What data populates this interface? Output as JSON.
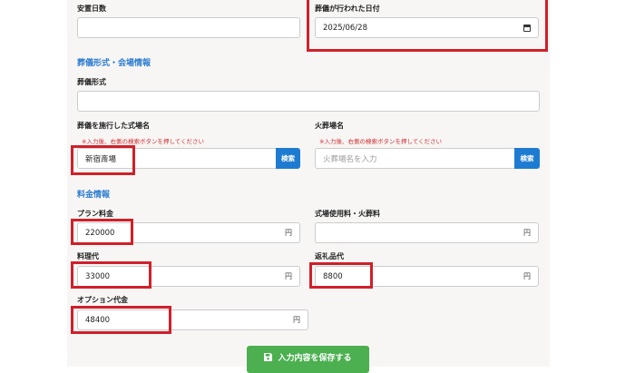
{
  "fields": {
    "anchi_days": {
      "label": "安置日数",
      "value": ""
    },
    "funeral_date": {
      "label": "葬儀が行われた日付",
      "value": "2025/06/28"
    },
    "funeral_type": {
      "label": "葬儀形式",
      "value": ""
    },
    "venue": {
      "label": "葬儀を施行した式場名",
      "note": "※入力後、右側の検索ボタンを押してください",
      "value": "新宿斎場",
      "search_label": "検索"
    },
    "crematorium": {
      "label": "火葬場名",
      "note": "※入力後、右側の検索ボタンを押してください",
      "placeholder": "火葬場名を入力",
      "search_label": "検索"
    },
    "plan_fee": {
      "label": "プラン料金",
      "value": "220000",
      "unit": "円"
    },
    "venue_fee": {
      "label": "式場使用料・火葬料",
      "value": "",
      "unit": "円"
    },
    "food_fee": {
      "label": "料理代",
      "value": "33000",
      "unit": "円"
    },
    "gift_fee": {
      "label": "返礼品代",
      "value": "8800",
      "unit": "円"
    },
    "option_fee": {
      "label": "オプション代金",
      "value": "48400",
      "unit": "円"
    }
  },
  "sections": {
    "venue_info": "葬儀形式・会場情報",
    "fee_info": "料金情報"
  },
  "save_button": {
    "label": "入力内容を保存する",
    "icon": "floppy-disk-icon"
  },
  "colors": {
    "accent": "#2a7bd0",
    "highlight": "#d0202a",
    "save": "#4caf50",
    "search": "#1e7bd2"
  }
}
